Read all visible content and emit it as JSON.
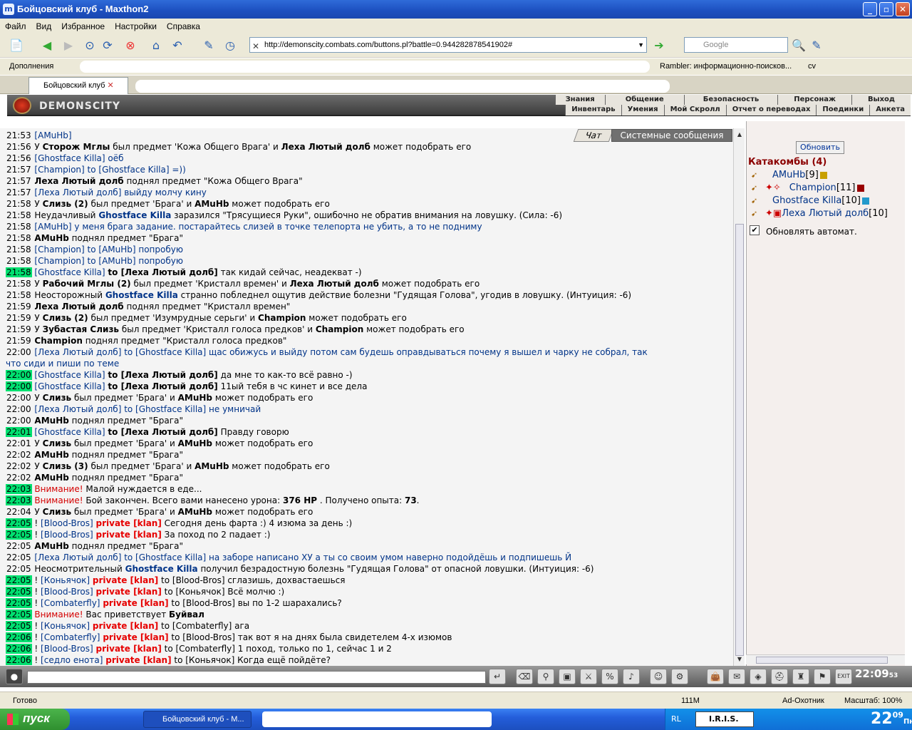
{
  "window": {
    "title": "Бойцовский клуб - Maxthon2",
    "app_icon": "m"
  },
  "menu": [
    "Файл",
    "Вид",
    "Избранное",
    "Настройки",
    "Справка"
  ],
  "address": {
    "url": "http://demonscity.combats.com/buttons.pl?battle=0.944282878541902#"
  },
  "search": {
    "placeholder": "Google"
  },
  "bookmarks": {
    "addons": "Дополнения",
    "rambler": "Rambler: информационно-поисков...",
    "cv": "cv"
  },
  "tab": {
    "label": "Бойцовский клуб"
  },
  "game": {
    "logo": "DEMONSCITY",
    "nav_top": [
      "Знания",
      "Общение",
      "Безопасность",
      "Персонаж",
      "Выход"
    ],
    "nav_bottom": [
      "Инвентарь",
      "Умения",
      "Мой Скролл",
      "Отчет о переводах",
      "Поединки",
      "Анкета"
    ]
  },
  "chat_tabs": {
    "chat": "Чат",
    "system": "Системные сообщения"
  },
  "chat": [
    {
      "t": "21:53",
      "h": false,
      "parts": [
        [
          "nm",
          "[AMuHb]"
        ]
      ]
    },
    {
      "t": "21:56",
      "h": false,
      "parts": [
        [
          "",
          "У "
        ],
        [
          "b",
          "Сторож Мглы"
        ],
        [
          "",
          " был предмет 'Кожа Общего Врага' и "
        ],
        [
          "b",
          "Леха Лютый долб"
        ],
        [
          "",
          " может подобрать его"
        ]
      ]
    },
    {
      "t": "21:56",
      "h": false,
      "parts": [
        [
          "nm",
          "[Ghostface Killa] оёб"
        ]
      ]
    },
    {
      "t": "21:57",
      "h": false,
      "parts": [
        [
          "nm",
          "[Champion] to [Ghostface Killa] =))"
        ]
      ]
    },
    {
      "t": "21:57",
      "h": false,
      "parts": [
        [
          "b",
          "Леха Лютый долб"
        ],
        [
          "",
          " поднял предмет \"Кожа Общего Врага\""
        ]
      ]
    },
    {
      "t": "21:57",
      "h": false,
      "parts": [
        [
          "nm",
          "[Леха Лютый долб] выйду молчу кину"
        ]
      ]
    },
    {
      "t": "21:58",
      "h": false,
      "parts": [
        [
          "",
          "У "
        ],
        [
          "b",
          "Слизь (2)"
        ],
        [
          "",
          " был предмет 'Брага' и "
        ],
        [
          "b",
          "AMuHb"
        ],
        [
          "",
          " может подобрать его"
        ]
      ]
    },
    {
      "t": "21:58",
      "h": false,
      "parts": [
        [
          "",
          "Неудачливый "
        ],
        [
          "nmb",
          "Ghostface Killa"
        ],
        [
          "",
          " заразился \"Трясущиеся Руки\", ошибочно не обратив внимания на ловушку. (Сила: -6)"
        ]
      ]
    },
    {
      "t": "21:58",
      "h": false,
      "parts": [
        [
          "nm",
          "[AMuHb] у меня брага задание. постарайтесь слизей в точке телепорта не убить, а то не подниму"
        ]
      ]
    },
    {
      "t": "21:58",
      "h": false,
      "parts": [
        [
          "b",
          "AMuHb"
        ],
        [
          "",
          " поднял предмет \"Брага\""
        ]
      ]
    },
    {
      "t": "21:58",
      "h": false,
      "parts": [
        [
          "nm",
          "[Champion] to [AMuHb] попробую"
        ]
      ]
    },
    {
      "t": "21:58",
      "h": false,
      "parts": [
        [
          "nm",
          "[Champion] to [AMuHb] попробую"
        ]
      ]
    },
    {
      "t": "21:58",
      "h": true,
      "parts": [
        [
          "nm",
          "[Ghostface Killa] "
        ],
        [
          "b",
          "to [Леха Лютый долб]"
        ],
        [
          "",
          " так кидай сейчас, неадекват -)"
        ]
      ]
    },
    {
      "t": "21:58",
      "h": false,
      "parts": [
        [
          "",
          "У "
        ],
        [
          "b",
          "Рабочий Мглы (2)"
        ],
        [
          "",
          " был предмет 'Кристалл времен' и "
        ],
        [
          "b",
          "Леха Лютый долб"
        ],
        [
          "",
          " может подобрать его"
        ]
      ]
    },
    {
      "t": "21:58",
      "h": false,
      "parts": [
        [
          "",
          "Неосторожный "
        ],
        [
          "nmb",
          "Ghostface Killa"
        ],
        [
          "",
          " странно побледнел ощутив действие болезни \"Гудящая Голова\", угодив в ловушку. (Интуиция: -6)"
        ]
      ]
    },
    {
      "t": "21:59",
      "h": false,
      "parts": [
        [
          "b",
          "Леха Лютый долб"
        ],
        [
          "",
          " поднял предмет \"Кристалл времен\""
        ]
      ]
    },
    {
      "t": "21:59",
      "h": false,
      "parts": [
        [
          "",
          "У "
        ],
        [
          "b",
          "Слизь (2)"
        ],
        [
          "",
          " был предмет 'Изумрудные серьги' и "
        ],
        [
          "b",
          "Champion"
        ],
        [
          "",
          " может подобрать его"
        ]
      ]
    },
    {
      "t": "21:59",
      "h": false,
      "parts": [
        [
          "",
          "У "
        ],
        [
          "b",
          "Зубастая Слизь"
        ],
        [
          "",
          " был предмет 'Кристалл голоса предков' и "
        ],
        [
          "b",
          "Champion"
        ],
        [
          "",
          " может подобрать его"
        ]
      ]
    },
    {
      "t": "21:59",
      "h": false,
      "parts": [
        [
          "b",
          "Champion"
        ],
        [
          "",
          " поднял предмет \"Кристалл голоса предков\""
        ]
      ]
    },
    {
      "t": "22:00",
      "h": false,
      "parts": [
        [
          "nm",
          "[Леха Лютый долб] to [Ghostface Killa] щас обижусь и выйду потом сам будешь оправдываться почему я вышел и чарку не собрал, так"
        ]
      ]
    },
    {
      "t": "",
      "h": false,
      "parts": [
        [
          "nm",
          "что сиди и пиши по теме"
        ]
      ],
      "cont": true
    },
    {
      "t": "22:00",
      "h": true,
      "parts": [
        [
          "nm",
          "[Ghostface Killa] "
        ],
        [
          "b",
          "to [Леха Лютый долб]"
        ],
        [
          "",
          " да мне то как-то всё равно -)"
        ]
      ]
    },
    {
      "t": "22:00",
      "h": true,
      "parts": [
        [
          "nm",
          "[Ghostface Killa] "
        ],
        [
          "b",
          "to [Леха Лютый долб]"
        ],
        [
          "",
          " 11ый тебя в чс кинет и все дела"
        ]
      ]
    },
    {
      "t": "22:00",
      "h": false,
      "parts": [
        [
          "",
          "У "
        ],
        [
          "b",
          "Слизь"
        ],
        [
          "",
          " был предмет 'Брага' и "
        ],
        [
          "b",
          "AMuHb"
        ],
        [
          "",
          " может подобрать его"
        ]
      ]
    },
    {
      "t": "22:00",
      "h": false,
      "parts": [
        [
          "nm",
          "[Леха Лютый долб] to [Ghostface Killa] не умничай"
        ]
      ]
    },
    {
      "t": "22:00",
      "h": false,
      "parts": [
        [
          "b",
          "AMuHb"
        ],
        [
          "",
          " поднял предмет \"Брага\""
        ]
      ]
    },
    {
      "t": "22:01",
      "h": true,
      "parts": [
        [
          "nm",
          "[Ghostface Killa] "
        ],
        [
          "b",
          "to [Леха Лютый долб]"
        ],
        [
          "",
          " Правду говорю"
        ]
      ]
    },
    {
      "t": "22:01",
      "h": false,
      "parts": [
        [
          "",
          "У "
        ],
        [
          "b",
          "Слизь"
        ],
        [
          "",
          " был предмет 'Брага' и "
        ],
        [
          "b",
          "AMuHb"
        ],
        [
          "",
          " может подобрать его"
        ]
      ]
    },
    {
      "t": "22:02",
      "h": false,
      "parts": [
        [
          "b",
          "AMuHb"
        ],
        [
          "",
          " поднял предмет \"Брага\""
        ]
      ]
    },
    {
      "t": "22:02",
      "h": false,
      "parts": [
        [
          "",
          "У "
        ],
        [
          "b",
          "Слизь (3)"
        ],
        [
          "",
          " был предмет 'Брага' и "
        ],
        [
          "b",
          "AMuHb"
        ],
        [
          "",
          " может подобрать его"
        ]
      ]
    },
    {
      "t": "22:02",
      "h": false,
      "parts": [
        [
          "b",
          "AMuHb"
        ],
        [
          "",
          " поднял предмет \"Брага\""
        ]
      ]
    },
    {
      "t": "22:03",
      "h": true,
      "parts": [
        [
          "warn",
          "Внимание!"
        ],
        [
          "",
          " Малой нуждается в еде..."
        ]
      ]
    },
    {
      "t": "22:03",
      "h": true,
      "parts": [
        [
          "warn",
          "Внимание!"
        ],
        [
          "",
          " Бой закончен. Всего вами нанесено урона: "
        ],
        [
          "b",
          "376 HP"
        ],
        [
          "",
          " . Получено опыта: "
        ],
        [
          "b",
          "73"
        ],
        [
          "",
          "."
        ]
      ]
    },
    {
      "t": "22:04",
      "h": false,
      "parts": [
        [
          "",
          "У "
        ],
        [
          "b",
          "Слизь"
        ],
        [
          "",
          " был предмет 'Брага' и "
        ],
        [
          "b",
          "AMuHb"
        ],
        [
          "",
          " может подобрать его"
        ]
      ]
    },
    {
      "t": "22:05",
      "h": true,
      "parts": [
        [
          "",
          "! "
        ],
        [
          "nm",
          "[Blood-Bros]"
        ],
        [
          "",
          " "
        ],
        [
          "pk",
          "private [klan]"
        ],
        [
          "",
          " Сегодня день фарта :) 4 изюма за день :)"
        ]
      ]
    },
    {
      "t": "22:05",
      "h": true,
      "parts": [
        [
          "",
          "! "
        ],
        [
          "nm",
          "[Blood-Bros]"
        ],
        [
          "",
          " "
        ],
        [
          "pk",
          "private [klan]"
        ],
        [
          "",
          " За поход по 2 падает :)"
        ]
      ]
    },
    {
      "t": "22:05",
      "h": false,
      "parts": [
        [
          "b",
          "AMuHb"
        ],
        [
          "",
          " поднял предмет \"Брага\""
        ]
      ]
    },
    {
      "t": "22:05",
      "h": false,
      "parts": [
        [
          "nm",
          "[Леха Лютый долб] to [Ghostface Killa] на заборе написано ХУ а ты со своим умом наверно подойдёшь и подпишешь Й"
        ]
      ]
    },
    {
      "t": "22:05",
      "h": false,
      "parts": [
        [
          "",
          "Неосмотрительный "
        ],
        [
          "nmb",
          "Ghostface Killa"
        ],
        [
          "",
          " получил безрадостную болезнь \"Гудящая Голова\" от опасной ловушки. (Интуиция: -6)"
        ]
      ]
    },
    {
      "t": "22:05",
      "h": true,
      "parts": [
        [
          "",
          "! "
        ],
        [
          "nm",
          "[Коньячок]"
        ],
        [
          "",
          " "
        ],
        [
          "pk",
          "private [klan]"
        ],
        [
          "",
          " to [Blood-Bros] сглазишь, дохвастаешься"
        ]
      ]
    },
    {
      "t": "22:05",
      "h": true,
      "parts": [
        [
          "",
          "! "
        ],
        [
          "nm",
          "[Blood-Bros]"
        ],
        [
          "",
          " "
        ],
        [
          "pk",
          "private [klan]"
        ],
        [
          "",
          " to [Коньячок] Всё молчю :)"
        ]
      ]
    },
    {
      "t": "22:05",
      "h": true,
      "parts": [
        [
          "",
          "! "
        ],
        [
          "nm",
          "[Combaterfly]"
        ],
        [
          "",
          " "
        ],
        [
          "pk",
          "private [klan]"
        ],
        [
          "",
          " to [Blood-Bros] вы по 1-2 шарахались?"
        ]
      ]
    },
    {
      "t": "22:05",
      "h": true,
      "parts": [
        [
          "warn",
          "Внимание!"
        ],
        [
          "",
          " Вас приветствует "
        ],
        [
          "b",
          "Буйвал"
        ]
      ]
    },
    {
      "t": "22:05",
      "h": true,
      "parts": [
        [
          "",
          "! "
        ],
        [
          "nm",
          "[Коньячок]"
        ],
        [
          "",
          " "
        ],
        [
          "pk",
          "private [klan]"
        ],
        [
          "",
          " to [Combaterfly] ага"
        ]
      ]
    },
    {
      "t": "22:06",
      "h": true,
      "parts": [
        [
          "",
          "! "
        ],
        [
          "nm",
          "[Combaterfly]"
        ],
        [
          "",
          " "
        ],
        [
          "pk",
          "private [klan]"
        ],
        [
          "",
          " to [Blood-Bros] так вот я на днях была свидетелем 4-х изюмов"
        ]
      ]
    },
    {
      "t": "22:06",
      "h": true,
      "parts": [
        [
          "",
          "! "
        ],
        [
          "nm",
          "[Blood-Bros]"
        ],
        [
          "",
          " "
        ],
        [
          "pk",
          "private [klan]"
        ],
        [
          "",
          " to [Combaterfly] 1 поход, только по 1, сейчас 1 и 2"
        ]
      ]
    },
    {
      "t": "22:06",
      "h": true,
      "parts": [
        [
          "",
          "! "
        ],
        [
          "nm",
          "[седло енота]"
        ],
        [
          "",
          " "
        ],
        [
          "pk",
          "private [klan]"
        ],
        [
          "",
          " to [Коньячок] Когда ещё пойдёте?"
        ]
      ]
    }
  ],
  "side": {
    "refresh": "Обновить",
    "location": "Катакомбы (4)",
    "players": [
      {
        "name": "AMuHb",
        "level": "[9]"
      },
      {
        "name": "Champion",
        "level": "[11]"
      },
      {
        "name": "Ghostface Killa",
        "level": "[10]"
      },
      {
        "name": "Леха Лютый долб",
        "level": "[10]"
      }
    ],
    "auto_refresh": "Обновлять автомат.",
    "auto_checked": "✔"
  },
  "clock": {
    "time": "22:09",
    "sec": "53"
  },
  "status": {
    "ready": "Готово",
    "memory": "111M",
    "ad": "Ad-Охотник",
    "zoom": "Масштаб: 100%"
  },
  "taskbar": {
    "start": "пуск",
    "task": "Бойцовский клуб - М...",
    "lang": "RL",
    "iris": "I.R.I.S.",
    "time": "22",
    "time2": "09",
    "dow": "Пн"
  }
}
